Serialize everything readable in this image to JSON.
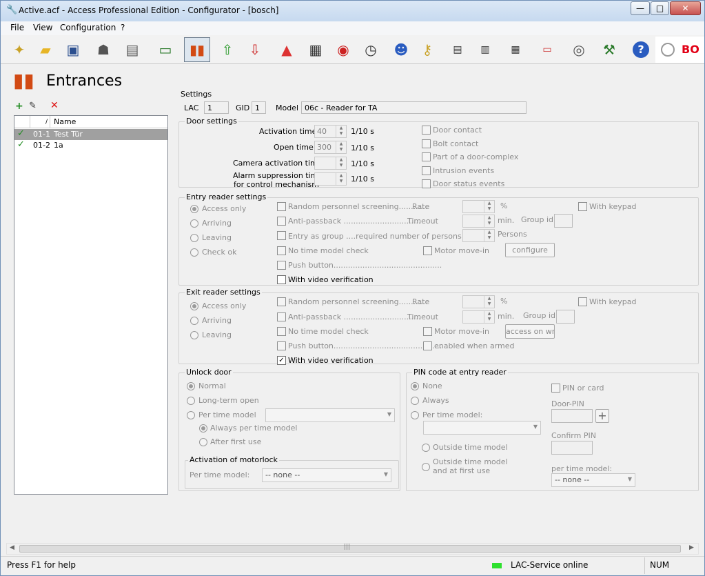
{
  "window": {
    "title": "Active.acf - Access Professional Edition - Configurator - [bosch]",
    "min_label": "—",
    "max_label": "□",
    "close_label": "✕"
  },
  "menu": {
    "items": [
      "File",
      "View",
      "Configuration",
      "?"
    ]
  },
  "toolbar": {
    "icons": [
      "new-file-icon",
      "open-folder-icon",
      "save-disk-icon",
      "persons-icon",
      "devices-icon",
      "card-reader-icon",
      "entrances-icon",
      "upload-icon",
      "download-icon",
      "signal-icon",
      "calendar-icon",
      "time-models-icon",
      "clock-icon",
      "personnel-groups-icon",
      "authorizations-icon",
      "text-import-icon",
      "text-export-icon",
      "database-icon",
      "card-design-icon",
      "video-icon",
      "network-icon",
      "help-icon"
    ],
    "bosch_label": "BO"
  },
  "page": {
    "title": "Entrances"
  },
  "list": {
    "col_sort": "/",
    "col_name": "Name",
    "rows": [
      {
        "id": "01-1",
        "name": "Test Tür",
        "active": true
      },
      {
        "id": "01-2",
        "name": "1a",
        "active": true
      }
    ]
  },
  "settings": {
    "title": "Settings",
    "lac_label": "LAC",
    "lac_value": "1",
    "gid_label": "GID",
    "gid_value": "1",
    "model_label": "Model",
    "model_value": "06c - Reader for TA"
  },
  "door": {
    "title": "Door settings",
    "activation_label": "Activation time",
    "activation_value": "40",
    "open_label": "Open time",
    "open_value": "300",
    "camera_label": "Camera activation time",
    "alarm_label1": "Alarm suppression time",
    "alarm_label2": "for control mechanism",
    "unit": "1/10 s",
    "checks": [
      "Door contact",
      "Bolt contact",
      "Part of a door-complex",
      "Intrusion events",
      "Door status events"
    ]
  },
  "entry": {
    "title": "Entry reader settings",
    "radios": [
      "Access only",
      "Arriving",
      "Leaving",
      "Check ok"
    ],
    "random": "Random personnel screening............",
    "rate": "Rate",
    "percent": "%",
    "anti": "Anti-passback ................................",
    "timeout": "Timeout",
    "min": "min.",
    "group_id": "Group id",
    "group": "Entry as group ....required number of persons",
    "persons": "Persons",
    "no_time": "No time model check",
    "motor": "Motor move-in",
    "configure": "configure",
    "push": "Push button.............................................",
    "video": "With video verification",
    "keypad": "With keypad"
  },
  "exit": {
    "title": "Exit reader settings",
    "radios": [
      "Access only",
      "Arriving",
      "Leaving"
    ],
    "random": "Random personnel screening............",
    "rate": "Rate",
    "percent": "%",
    "anti": "Anti-passback ................................",
    "timeout": "Timeout",
    "min": "min.",
    "group_id": "Group id",
    "no_time": "No time model check",
    "motor": "Motor move-in",
    "access_btn": "access on writ",
    "push": "Push button.............................................",
    "armed": "enabled when armed",
    "video": "With video verification",
    "keypad": "With keypad"
  },
  "unlock": {
    "title": "Unlock door",
    "normal": "Normal",
    "long": "Long-term open",
    "per_time": "Per time model",
    "always": "Always per time model",
    "after": "After first use",
    "motorlock_title": "Activation of motorlock",
    "motorlock_label": "Per time model:",
    "motorlock_value": "-- none --"
  },
  "pin": {
    "title": "PIN code at entry reader",
    "none": "None",
    "always": "Always",
    "per_time": "Per time model:",
    "outside": "Outside time model",
    "outside_first1": "Outside time model",
    "outside_first2": "and at first use",
    "pin_or_card": "PIN or card",
    "door_pin": "Door-PIN",
    "confirm": "Confirm PIN",
    "per_time_model": "per time model:",
    "per_time_value": "-- none --"
  },
  "status": {
    "help": "Press F1 for help",
    "service": "LAC-Service online",
    "num": "NUM",
    "service_color": "#2ee02e"
  }
}
